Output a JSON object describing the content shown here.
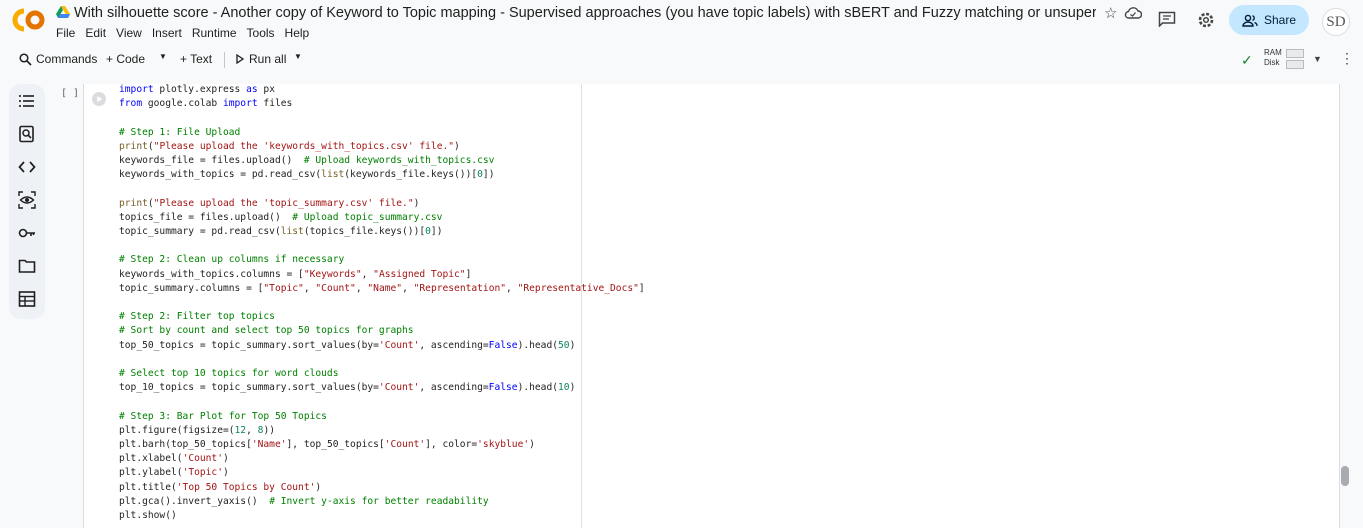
{
  "header": {
    "title": "With silhouette score - Another copy of Keyword to Topic mapping - Supervised approaches (you have topic labels) with sBERT and Fuzzy matching or unsupervised (yo…",
    "menu": [
      "File",
      "Edit",
      "View",
      "Insert",
      "Runtime",
      "Tools",
      "Help"
    ],
    "share_label": "Share",
    "avatar_initials": "SD",
    "logo_text": "CO"
  },
  "toolbar": {
    "commands_label": "Commands",
    "code_label": "+ Code",
    "text_label": "+ Text",
    "run_all_label": "Run all",
    "ram_label": "RAM",
    "disk_label": "Disk"
  },
  "sidebar": {
    "icons": [
      "table-of-contents-icon",
      "find-replace-icon",
      "code-snippets-icon",
      "variable-inspector-icon",
      "secrets-key-icon",
      "files-folder-icon",
      "terminal-table-icon"
    ]
  },
  "cell": {
    "execution_bracket": "[ ]",
    "code_lines": [
      "import plotly.express as px",
      "from google.colab import files",
      "",
      "# Step 1: File Upload",
      "print(\"Please upload the 'keywords_with_topics.csv' file.\")",
      "keywords_file = files.upload()  # Upload keywords_with_topics.csv",
      "keywords_with_topics = pd.read_csv(list(keywords_file.keys())[0])",
      "",
      "print(\"Please upload the 'topic_summary.csv' file.\")",
      "topics_file = files.upload()  # Upload topic_summary.csv",
      "topic_summary = pd.read_csv(list(topics_file.keys())[0])",
      "",
      "# Step 2: Clean up columns if necessary",
      "keywords_with_topics.columns = [\"Keywords\", \"Assigned Topic\"]",
      "topic_summary.columns = [\"Topic\", \"Count\", \"Name\", \"Representation\", \"Representative_Docs\"]",
      "",
      "# Step 2: Filter top topics",
      "# Sort by count and select top 50 topics for graphs",
      "top_50_topics = topic_summary.sort_values(by='Count', ascending=False).head(50)",
      "",
      "# Select top 10 topics for word clouds",
      "top_10_topics = topic_summary.sort_values(by='Count', ascending=False).head(10)",
      "",
      "# Step 3: Bar Plot for Top 50 Topics",
      "plt.figure(figsize=(12, 8))",
      "plt.barh(top_50_topics['Name'], top_50_topics['Count'], color='skyblue')",
      "plt.xlabel('Count')",
      "plt.ylabel('Topic')",
      "plt.title('Top 50 Topics by Count')",
      "plt.gca().invert_yaxis()  # Invert y-axis for better readability",
      "plt.show()"
    ]
  },
  "colors": {
    "share_bg": "#c2e7ff",
    "logo_orange": "#f9ab00",
    "keyword_blue": "#0000ff",
    "comment_green": "#008000",
    "string_red": "#a31515",
    "number_teal": "#098658"
  }
}
